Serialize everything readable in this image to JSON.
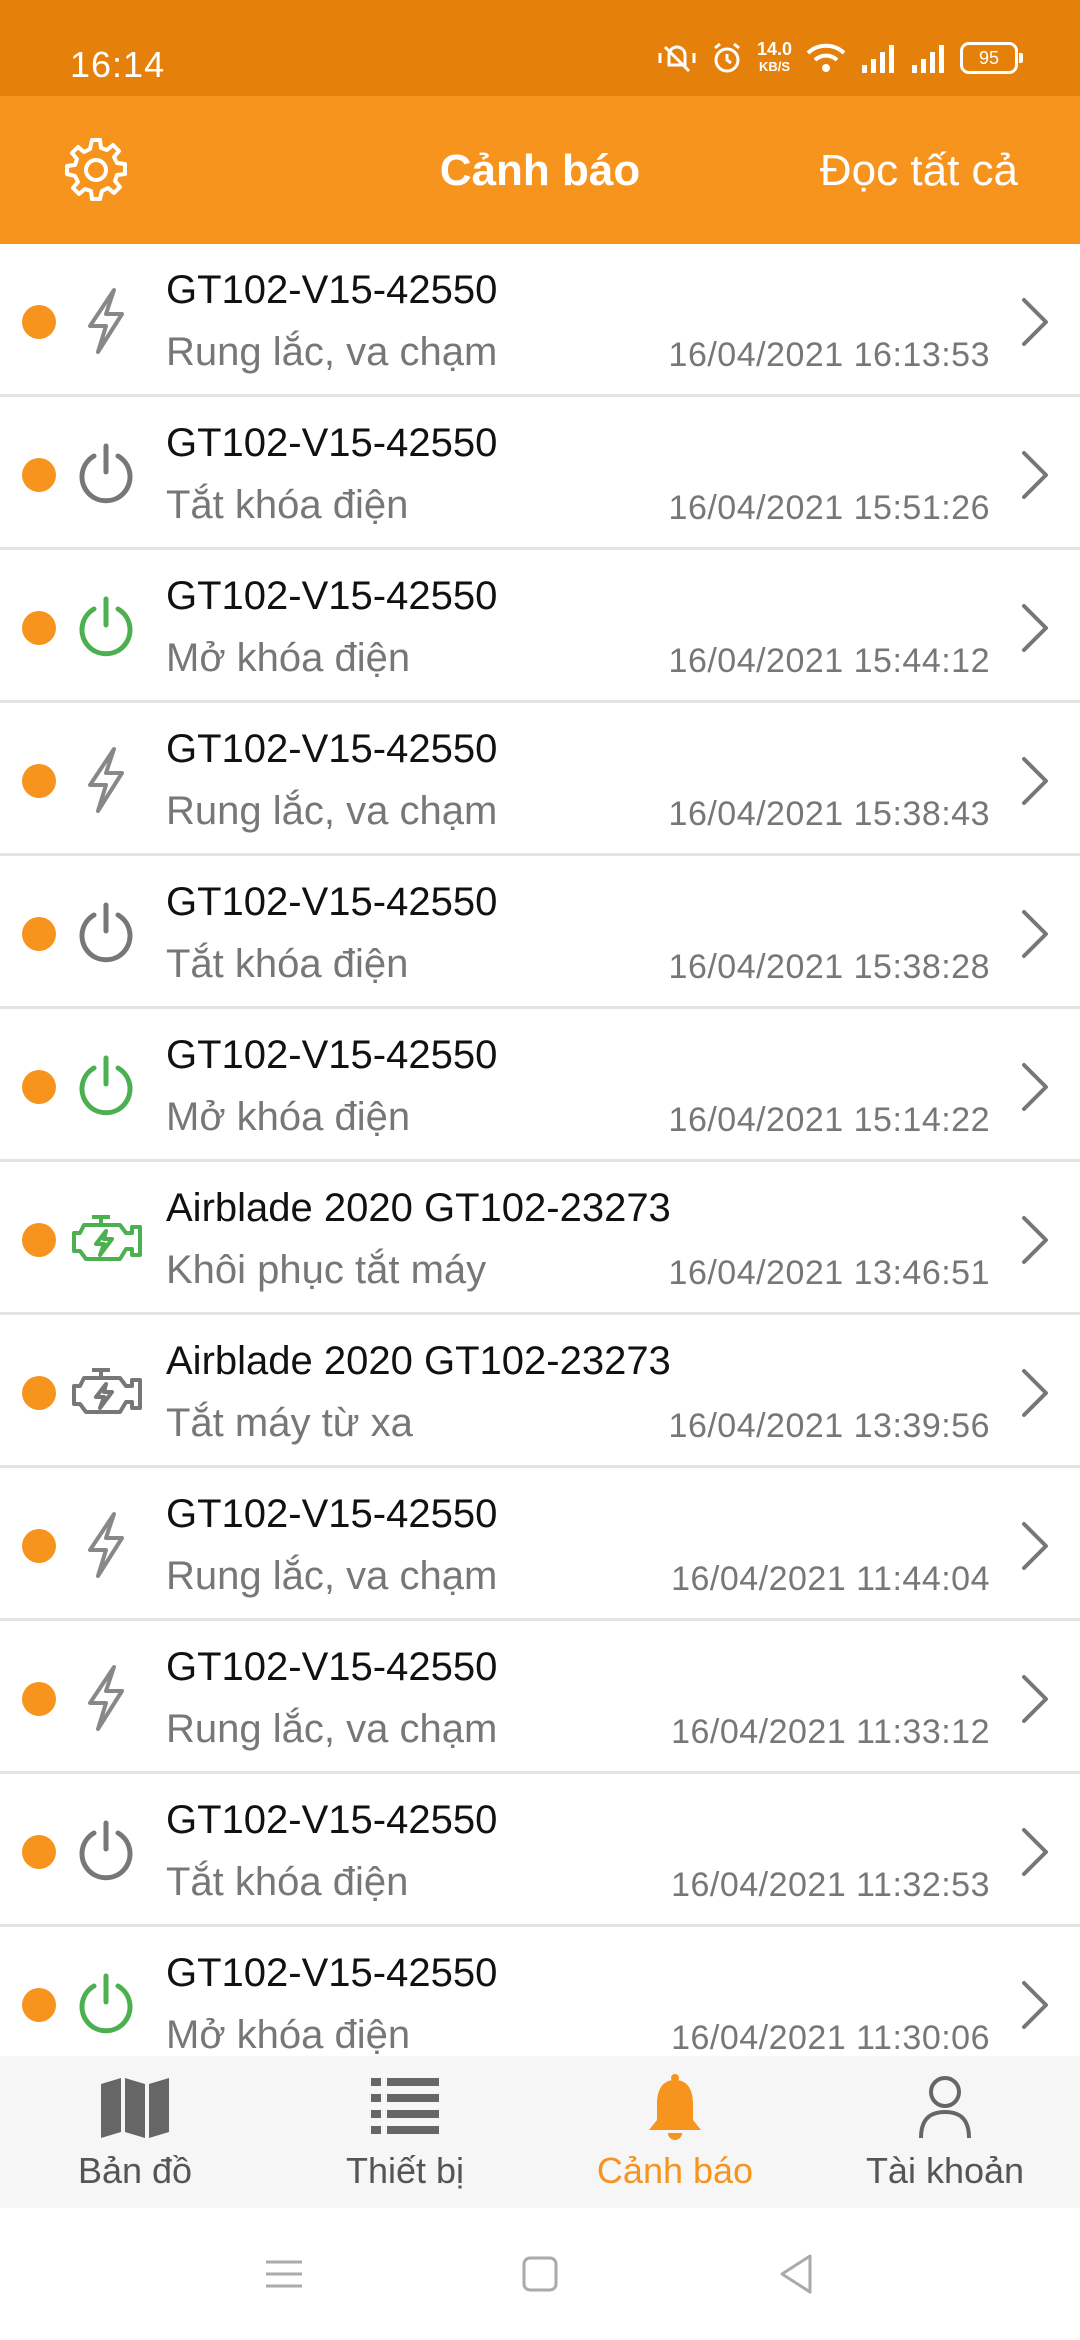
{
  "status_bar": {
    "time": "16:14",
    "net_speed_value": "14.0",
    "net_speed_unit": "KB/S",
    "battery": "95"
  },
  "header": {
    "title": "Cảnh báo",
    "read_all_label": "Đọc tất cả",
    "settings_icon": "gear-icon"
  },
  "colors": {
    "primary": "#F7941D",
    "status_bar": "#E5810B",
    "green": "#4CAF50",
    "gray_icon": "#777777"
  },
  "alerts": [
    {
      "device": "GT102-V15-42550",
      "event": "Rung lắc, va chạm",
      "time": "16/04/2021 16:13:53",
      "icon": "lightning-icon"
    },
    {
      "device": "GT102-V15-42550",
      "event": "Tắt khóa điện",
      "time": "16/04/2021 15:51:26",
      "icon": "power-off-icon"
    },
    {
      "device": "GT102-V15-42550",
      "event": "Mở khóa điện",
      "time": "16/04/2021 15:44:12",
      "icon": "power-on-icon"
    },
    {
      "device": "GT102-V15-42550",
      "event": "Rung lắc, va chạm",
      "time": "16/04/2021 15:38:43",
      "icon": "lightning-icon"
    },
    {
      "device": "GT102-V15-42550",
      "event": "Tắt khóa điện",
      "time": "16/04/2021 15:38:28",
      "icon": "power-off-icon"
    },
    {
      "device": "GT102-V15-42550",
      "event": "Mở khóa điện",
      "time": "16/04/2021 15:14:22",
      "icon": "power-on-icon"
    },
    {
      "device": "Airblade 2020 GT102-23273",
      "event": "Khôi phục tắt máy",
      "time": "16/04/2021 13:46:51",
      "icon": "engine-restore-icon"
    },
    {
      "device": "Airblade 2020 GT102-23273",
      "event": "Tắt máy từ xa",
      "time": "16/04/2021 13:39:56",
      "icon": "engine-off-icon"
    },
    {
      "device": "GT102-V15-42550",
      "event": "Rung lắc, va chạm",
      "time": "16/04/2021 11:44:04",
      "icon": "lightning-icon"
    },
    {
      "device": "GT102-V15-42550",
      "event": "Rung lắc, va chạm",
      "time": "16/04/2021 11:33:12",
      "icon": "lightning-icon"
    },
    {
      "device": "GT102-V15-42550",
      "event": "Tắt khóa điện",
      "time": "16/04/2021 11:32:53",
      "icon": "power-off-icon"
    },
    {
      "device": "GT102-V15-42550",
      "event": "Mở khóa điện",
      "time": "16/04/2021 11:30:06",
      "icon": "power-on-icon"
    }
  ],
  "bottom_nav": [
    {
      "label": "Bản đồ",
      "icon": "map-icon",
      "active": false
    },
    {
      "label": "Thiết bị",
      "icon": "list-icon",
      "active": false
    },
    {
      "label": "Cảnh báo",
      "icon": "bell-icon",
      "active": true
    },
    {
      "label": "Tài khoản",
      "icon": "user-icon",
      "active": false
    }
  ]
}
